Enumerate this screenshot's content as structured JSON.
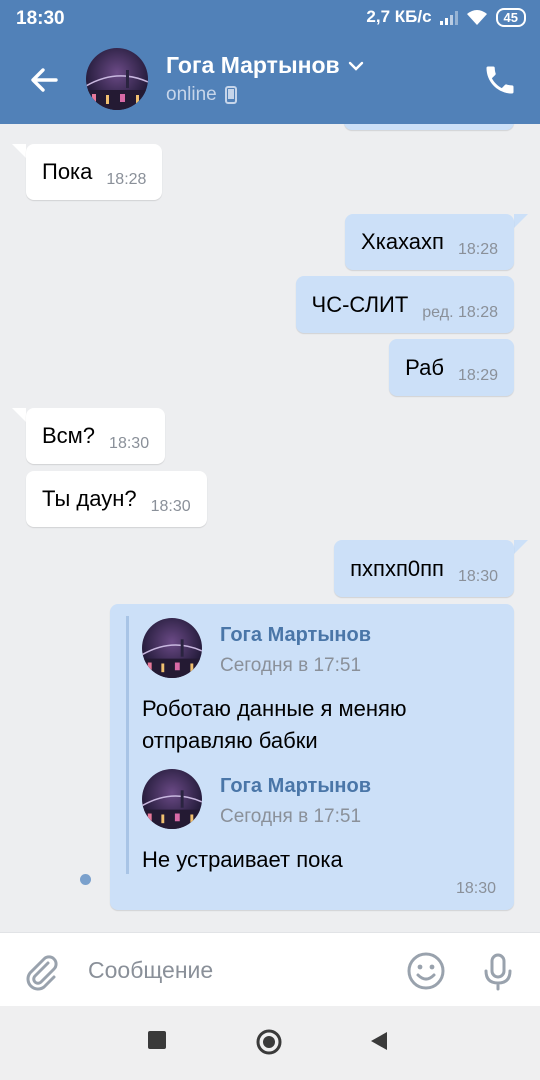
{
  "status_bar": {
    "time": "18:30",
    "net_speed": "2,7 КБ/с",
    "battery": "45"
  },
  "header": {
    "contact_name": "Гога Мартынов",
    "contact_status": "online"
  },
  "messages": [
    {
      "text": "Пока",
      "time": "18:28"
    },
    {
      "text": "Xкахахп",
      "time": "18:28"
    },
    {
      "text": "ЧС-СЛИТ",
      "time": "ред. 18:28"
    },
    {
      "text": "Раб",
      "time": "18:29"
    },
    {
      "text": "Всм?",
      "time": "18:30"
    },
    {
      "text": "Ты даун?",
      "time": "18:30"
    },
    {
      "text": "пхпхп0пп",
      "time": "18:30"
    }
  ],
  "forwarded": {
    "time": "18:30",
    "items": [
      {
        "author": "Гога Мартынов",
        "date": "Сегодня в 17:51",
        "text_line1": "Роботаю данные я меняю",
        "text_line2": "отправляю бабки"
      },
      {
        "author": "Гога Мартынов",
        "date": "Сегодня в 17:51",
        "text_line1": "Не устраивает пока"
      }
    ]
  },
  "composer": {
    "placeholder": "Сообщение"
  },
  "colors": {
    "header": "#5181b8",
    "outgoing": "#cce0f8",
    "incoming": "#ffffff",
    "background": "#edeef0",
    "link": "#4a76a8"
  },
  "icons": [
    "back-arrow-icon",
    "chevron-down-icon",
    "mobile-icon",
    "phone-icon",
    "attach-icon",
    "emoji-icon",
    "mic-icon",
    "recent-apps-icon",
    "home-icon",
    "back-icon"
  ]
}
